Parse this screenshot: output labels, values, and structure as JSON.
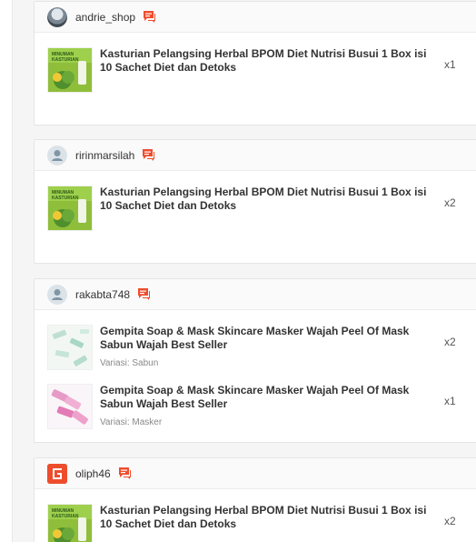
{
  "orders": [
    {
      "username": "andrie_shop",
      "avatar": "shop-avatar",
      "items": [
        {
          "name": "Kasturian Pelangsing Herbal BPOM Diet Nutrisi Busui 1 Box isi 10 Sachet Diet dan Detoks",
          "variant": "",
          "qty": "x1",
          "image": "kasturian-product"
        }
      ]
    },
    {
      "username": "ririnmarsilah",
      "avatar": "default-user",
      "items": [
        {
          "name": "Kasturian Pelangsing Herbal BPOM Diet Nutrisi Busui 1 Box isi 10 Sachet Diet dan Detoks",
          "variant": "",
          "qty": "x2",
          "image": "kasturian-product"
        }
      ]
    },
    {
      "username": "rakabta748",
      "avatar": "default-user",
      "items": [
        {
          "name": "Gempita Soap & Mask Skincare Masker Wajah Peel Of Mask Sabun Wajah Best Seller",
          "variant": "Variasi: Sabun",
          "qty": "x2",
          "image": "soap-product"
        },
        {
          "name": "Gempita Soap & Mask Skincare Masker Wajah Peel Of Mask Sabun Wajah Best Seller",
          "variant": "Variasi: Masker",
          "qty": "x1",
          "image": "mask-product"
        }
      ]
    },
    {
      "username": "oliph46",
      "avatar": "brand-avatar",
      "items": [
        {
          "name": "Kasturian Pelangsing Herbal BPOM Diet Nutrisi Busui 1 Box isi 10 Sachet Diet dan Detoks",
          "variant": "",
          "qty": "x2",
          "image": "kasturian-product"
        }
      ]
    }
  ],
  "colors": {
    "chat_icon": "#ee4d2d",
    "accent": "#ee4d2d"
  }
}
